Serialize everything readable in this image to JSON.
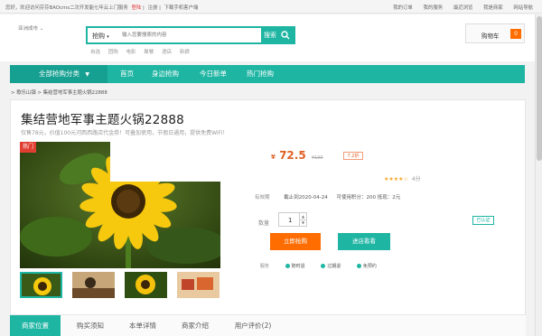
{
  "topbar": {
    "welcome": "您好，欢迎访问芬芬BAOcms二次开发能七年云上门服务",
    "login": "登陆",
    "separator": "|",
    "register": "注册",
    "download": "下载手机客户端",
    "links": [
      "我的订单",
      "我的服务",
      "最近浏览",
      "我是商家",
      "网站导航"
    ]
  },
  "header": {
    "city": "亚洲成市",
    "search_select": "抢购",
    "search_placeholder": "输入您要搜索的内容",
    "search_button": "搜索",
    "hot_words": [
      "自选",
      "团购",
      "电影",
      "聚餐",
      "酒店",
      "新娘"
    ],
    "cart_label": "购物车",
    "cart_count": "0"
  },
  "nav": {
    "category": "全部抢购分类",
    "items": [
      "首页",
      "身边抢购",
      "今日新单",
      "热门抢购"
    ]
  },
  "breadcrumb": "> 歌乐山镇 > 集结营地军事主题火锅22888",
  "product": {
    "title": "集结营地军事主题火锅22888",
    "subtitle": "仅售78元，价值100元河西西路店代金券！可叠加使用，节假日通用，提供免费WiFi！",
    "hot_badge": "热门",
    "price_symbol": "¥",
    "price": "72.5",
    "original_price": "¥100",
    "discount": "7.2折",
    "stars": "★★★★☆",
    "score": "4分",
    "validity_label": "有效期",
    "validity": "截止到2020-04-24",
    "points": "可使用积分：200  抵现：2元",
    "qty_label": "数量",
    "qty": "1",
    "buy_button": "立即抢购",
    "shop_button": "进店看看",
    "service_label": "服务",
    "services": [
      "随时退",
      "过期退",
      "免预约"
    ],
    "certified": "已认证"
  },
  "tabs": [
    "商家位置",
    "购买须知",
    "本单详情",
    "商家介绍",
    "用户评价(2)"
  ],
  "colors": {
    "accent": "#1fb5a3",
    "orange": "#ff6c00",
    "price": "#e05f24"
  }
}
